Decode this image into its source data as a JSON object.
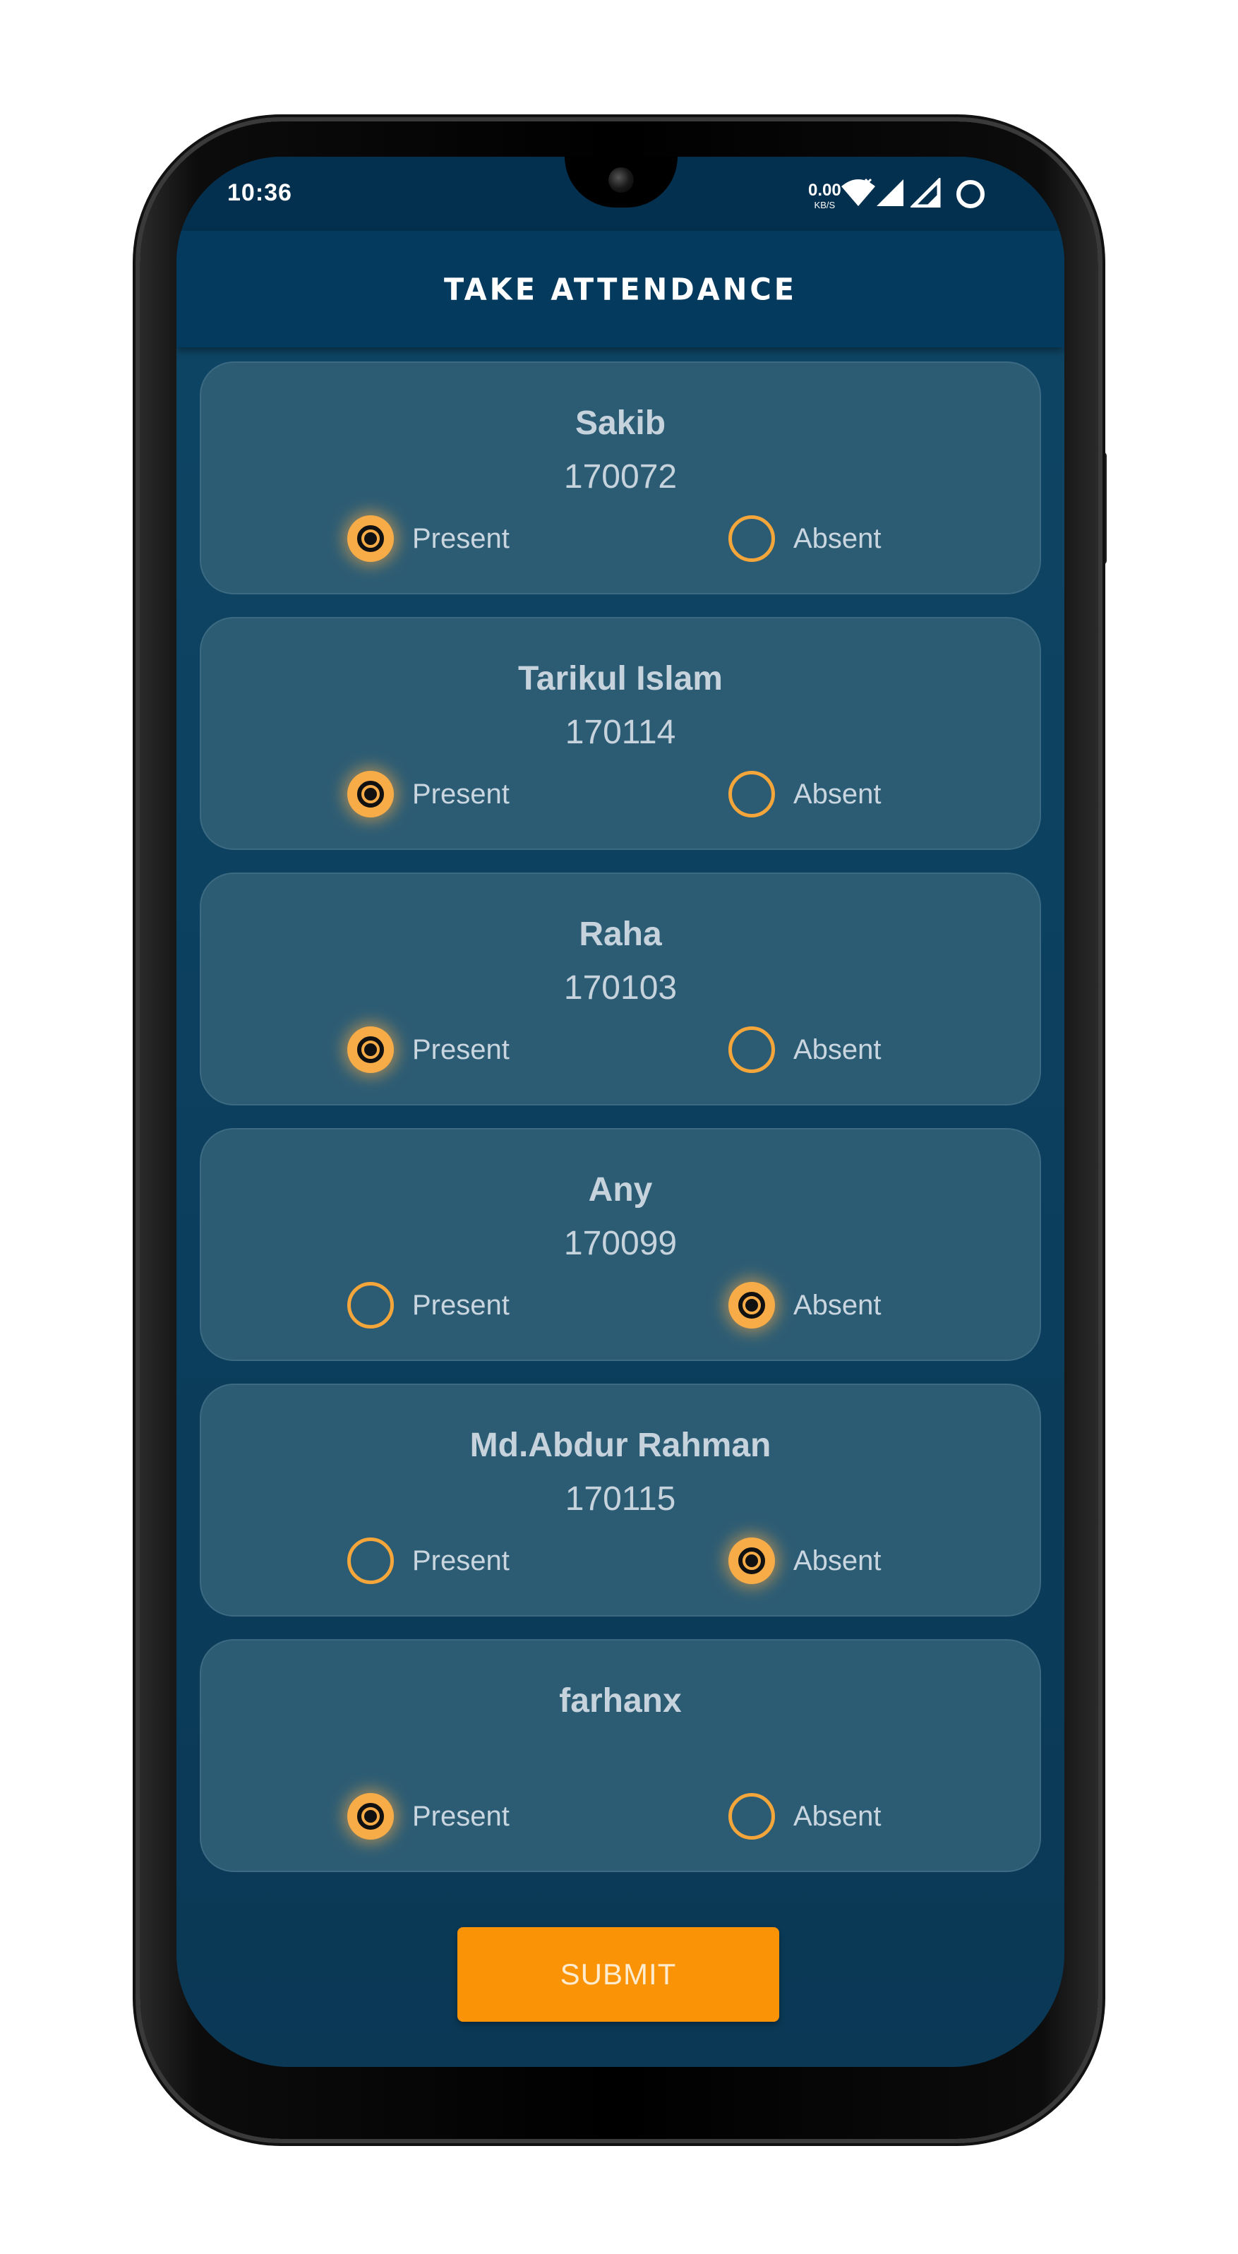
{
  "status_bar": {
    "time": "10:36",
    "net_speed_value": "0.00",
    "net_speed_unit": "KB/S",
    "icons": [
      "wifi-icon",
      "signal-icon",
      "signal-icon-2",
      "battery-icon"
    ]
  },
  "app_bar": {
    "title": "TAKE ATTENDANCE"
  },
  "labels": {
    "present": "Present",
    "absent": "Absent"
  },
  "students": [
    {
      "name": "Sakib",
      "id": "170072",
      "status": "present"
    },
    {
      "name": "Tarikul Islam",
      "id": "170114",
      "status": "present"
    },
    {
      "name": "Raha",
      "id": "170103",
      "status": "present"
    },
    {
      "name": "Any",
      "id": "170099",
      "status": "absent"
    },
    {
      "name": "Md.Abdur Rahman",
      "id": "170115",
      "status": "absent"
    },
    {
      "name": "farhanx",
      "id": "",
      "status": "present"
    }
  ],
  "submit_label": "SUBMIT",
  "colors": {
    "accent": "#fb9307",
    "card": "#2c5c74",
    "appbar": "#033a5d",
    "radio": "#f5a63a"
  }
}
